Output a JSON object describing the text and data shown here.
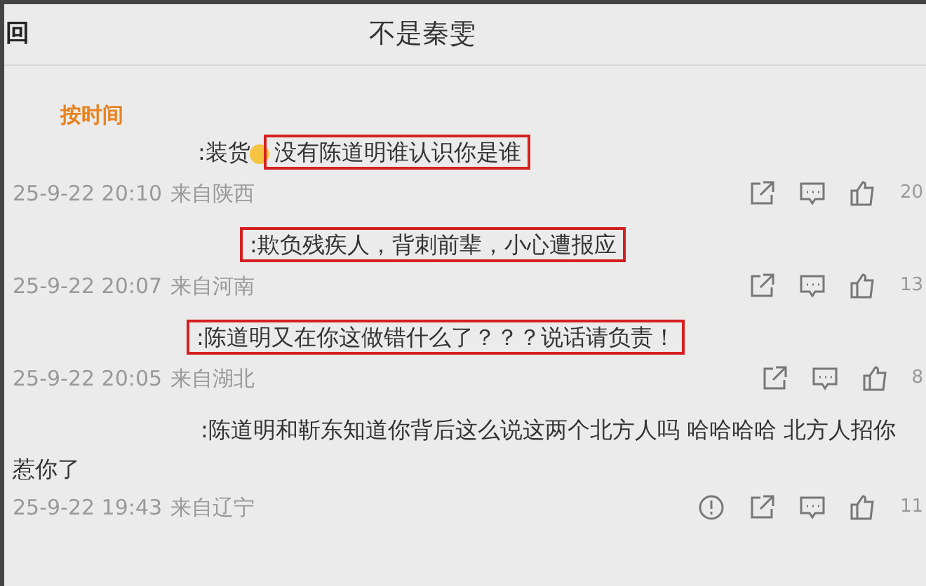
{
  "header": {
    "back": "回",
    "title": "不是秦雯"
  },
  "sort_tabs": [
    {
      "label": "按时间",
      "selected": true
    }
  ],
  "comments": [
    {
      "prefix": ":装货",
      "emoji": true,
      "text": "没有陈道明谁认识你是谁",
      "boxed": true,
      "time": "25-9-22 20:10",
      "location": "来自陕西",
      "report": false,
      "likes": "20"
    },
    {
      "emoji": false,
      "text": ":欺负残疾人，背刺前辈，小心遭报应",
      "boxed": true,
      "time": "25-9-22 20:07",
      "location": "来自河南",
      "report": false,
      "likes": "13"
    },
    {
      "emoji": false,
      "text": ":陈道明又在你这做错什么了？？？说话请负责！",
      "boxed": true,
      "time": "25-9-22 20:05",
      "location": "来自湖北",
      "report": false,
      "likes": "8"
    },
    {
      "emoji": false,
      "text": ":陈道明和靳东知道你背后这么说这两个北方人吗 哈哈哈哈 北方人招你惹你了",
      "boxed": false,
      "time": "25-9-22 19:43",
      "location": "来自辽宁",
      "report": true,
      "likes": "11"
    }
  ]
}
